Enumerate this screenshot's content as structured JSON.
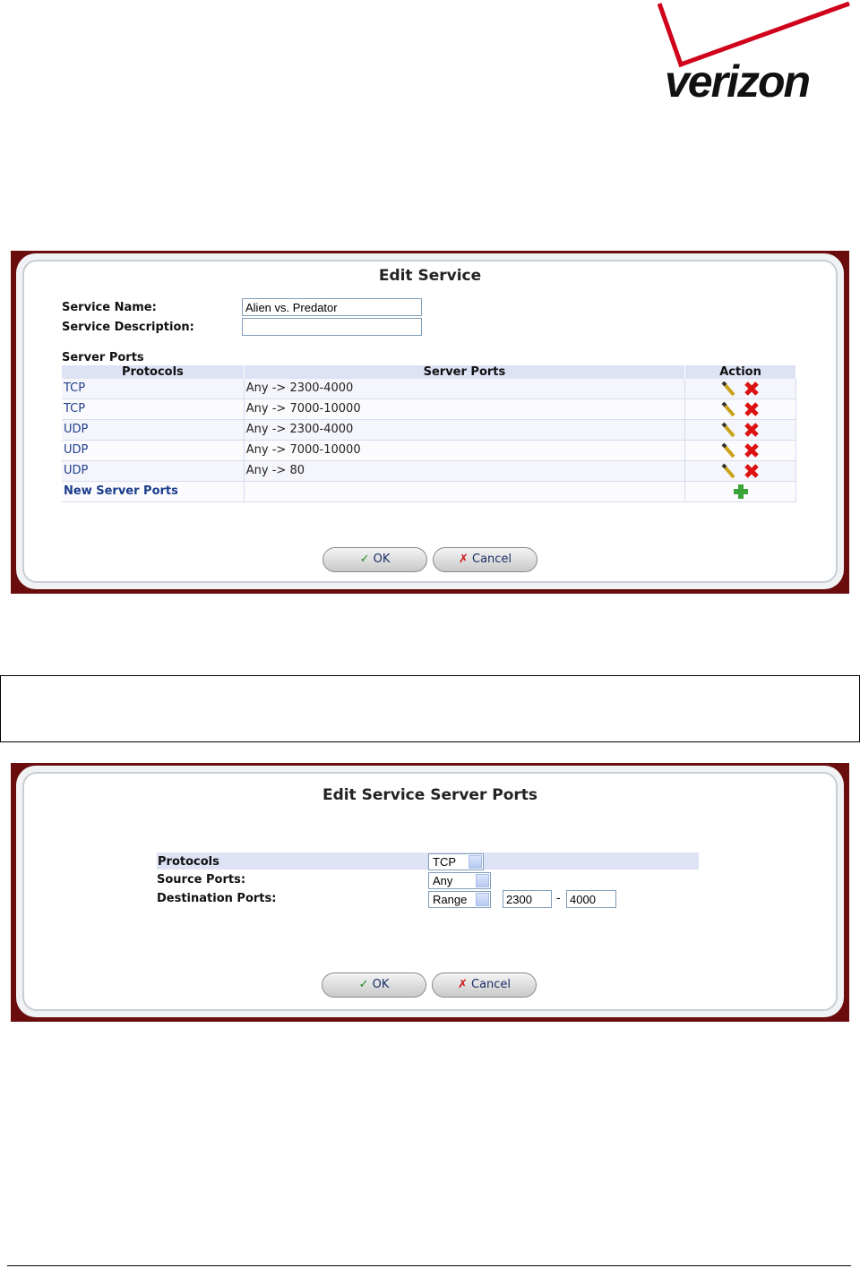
{
  "logo": {
    "text": "verizon"
  },
  "edit_service": {
    "title": "Edit Service",
    "service_name_label": "Service Name:",
    "service_name_value": "Alien vs. Predator",
    "service_description_label": "Service Description:",
    "service_description_value": "",
    "server_ports_label": "Server Ports",
    "columns": [
      "Protocols",
      "Server Ports",
      "Action"
    ],
    "rows": [
      {
        "protocol": "TCP",
        "ports": "Any -> 2300-4000"
      },
      {
        "protocol": "TCP",
        "ports": "Any -> 7000-10000"
      },
      {
        "protocol": "UDP",
        "ports": "Any -> 2300-4000"
      },
      {
        "protocol": "UDP",
        "ports": "Any -> 7000-10000"
      },
      {
        "protocol": "UDP",
        "ports": "Any -> 80"
      }
    ],
    "new_server_ports_label": "New Server Ports",
    "ok_label": "OK",
    "cancel_label": "Cancel"
  },
  "edit_server_ports": {
    "title": "Edit Service Server Ports",
    "protocols_label": "Protocols",
    "protocols_value": "TCP",
    "source_ports_label": "Source Ports:",
    "source_ports_value": "Any",
    "destination_ports_label": "Destination Ports:",
    "destination_ports_value": "Range",
    "range_from": "2300",
    "range_separator": "-",
    "range_to": "4000",
    "ok_label": "OK",
    "cancel_label": "Cancel"
  },
  "icons": {
    "edit": "pencil-icon",
    "delete": "red-x-icon",
    "add": "green-plus-icon",
    "ok": "checkmark-icon",
    "cancel": "x-mark-icon"
  }
}
